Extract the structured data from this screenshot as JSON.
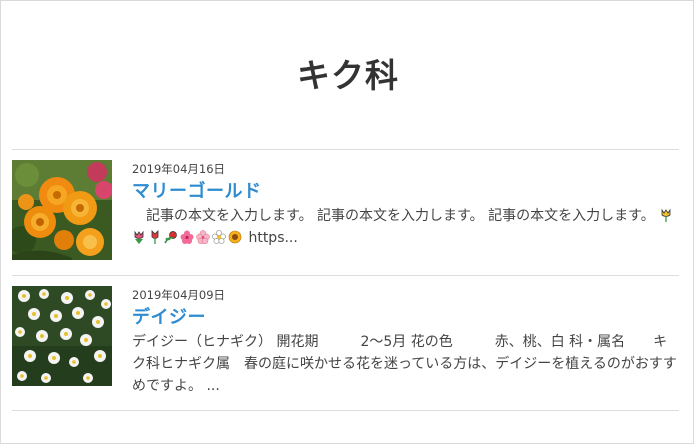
{
  "page": {
    "title": "キク科"
  },
  "posts": [
    {
      "date": "2019年04月16日",
      "title": "マリーゴールド",
      "excerpt_text": "　記事の本文を入力します。 記事の本文を入力します。 記事の本文を入力します。",
      "emoji_icons": [
        "tulip-icon",
        "tulip-icon",
        "tulip-icon",
        "rose-icon",
        "hibiscus-icon",
        "cherry-blossom-icon",
        "blossom-icon",
        "sunflower-icon"
      ],
      "excerpt_tail": "https...",
      "thumb_alt": "marigold photo"
    },
    {
      "date": "2019年04月09日",
      "title": "デイジー",
      "excerpt_text": "デイジー（ヒナギク） 開花期　　　2～5月 花の色　　　赤、桃、白 科・属名　　キク科ヒナギク属　春の庭に咲かせる花を迷っている方は、デイジーを植えるのがおすすめですよ。 ...",
      "thumb_alt": "daisy photo"
    }
  ],
  "colors": {
    "title": "#333333",
    "link": "#2f8cd0",
    "divider": "#dddddd"
  }
}
